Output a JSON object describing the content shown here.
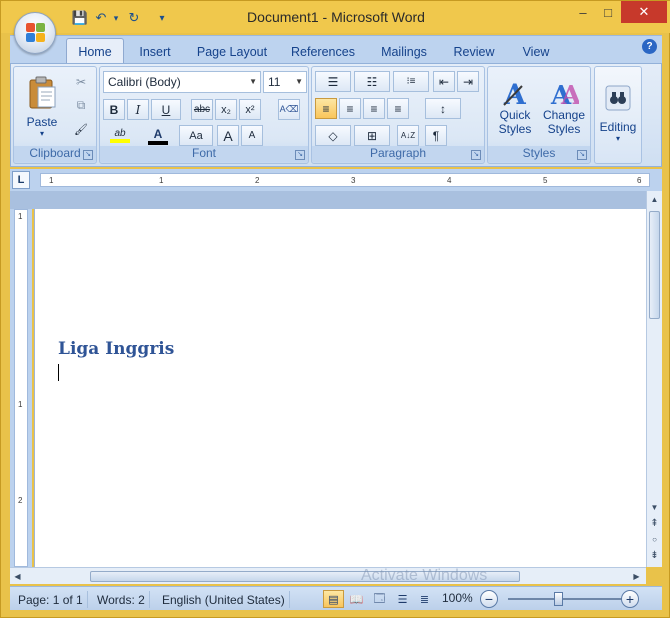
{
  "window": {
    "title": "Document1 - Microsoft Word",
    "minimize": "–",
    "maximize": "□",
    "close": "✕"
  },
  "quick_access": {
    "save_icon": "💾",
    "undo_icon": "↶",
    "undo_dropdown": "▾",
    "redo_icon": "↻",
    "customize_icon": "▾"
  },
  "tabs": [
    {
      "label": "Home",
      "active": true
    },
    {
      "label": "Insert"
    },
    {
      "label": "Page Layout"
    },
    {
      "label": "References"
    },
    {
      "label": "Mailings"
    },
    {
      "label": "Review"
    },
    {
      "label": "View"
    }
  ],
  "help": "?",
  "ribbon": {
    "clipboard": {
      "label": "Clipboard",
      "paste_label": "Paste",
      "paste_arrow": "▾",
      "cut_icon": "✂",
      "copy_icon": "⧉",
      "format_painter_icon": "🖌"
    },
    "font": {
      "label": "Font",
      "font_name": "Calibri (Body)",
      "font_size": "11",
      "bold": "B",
      "italic": "I",
      "underline": "U",
      "strikethrough": "abc",
      "subscript": "x₂",
      "superscript": "x²",
      "clear_format_icon": "A⌫",
      "highlight": "ab",
      "font_color": "A",
      "change_case": "Aa",
      "grow": "A",
      "shrink": "A"
    },
    "paragraph": {
      "label": "Paragraph",
      "bullets_icon": "☰",
      "numbering_icon": "☷",
      "multilevel_icon": "⁝≡",
      "decrease_indent_icon": "⇤",
      "increase_indent_icon": "⇥",
      "align_left_icon": "≡",
      "center_icon": "≡",
      "align_right_icon": "≡",
      "justify_icon": "≡",
      "line_spacing_icon": "↕",
      "shading_icon": "◇",
      "borders_icon": "⊞",
      "sort_icon": "A↓Z",
      "show_marks": "¶"
    },
    "styles": {
      "label": "Styles",
      "quick_styles_line1": "Quick",
      "quick_styles_line2": "Styles",
      "change_styles_line1": "Change",
      "change_styles_line2": "Styles"
    },
    "editing": {
      "label": "Editing"
    },
    "launcher_icon": "↘"
  },
  "ruler": {
    "tab_selector": "L",
    "marks": [
      "1",
      "1",
      "2",
      "3",
      "4",
      "5",
      "6"
    ],
    "vertical_marks": [
      "1",
      "1",
      "2"
    ]
  },
  "document": {
    "heading": "Liga Inggris"
  },
  "scrollbar": {
    "up": "▲",
    "down": "▼",
    "left": "◀",
    "right": "▶",
    "prev_page": "⇞",
    "select_browse": "○",
    "next_page": "⇟"
  },
  "status": {
    "page": "Page: 1 of 1",
    "words": "Words: 2",
    "language": "English (United States)",
    "zoom": "100%",
    "zoom_out": "−",
    "zoom_in": "+"
  },
  "watermark": "Activate Windows",
  "colors": {
    "accent": "#2f5496",
    "title_bar": "#f0c84c",
    "ribbon": "#dbe7f5",
    "close": "#c7392b"
  }
}
